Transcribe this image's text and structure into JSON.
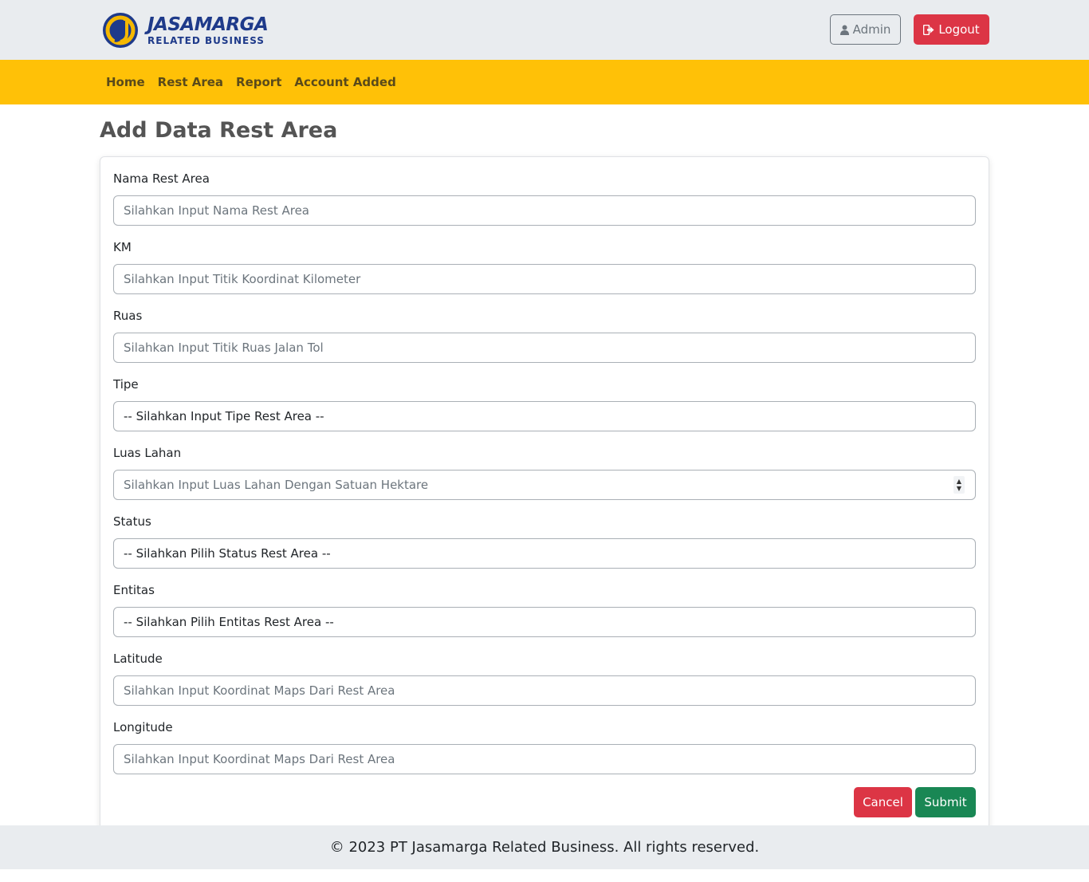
{
  "header": {
    "brand_name": "JASAMARGA",
    "brand_sub": "RELATED BUSINESS",
    "admin_label": "Admin",
    "logout_label": "Logout"
  },
  "nav": {
    "items": [
      {
        "label": "Home"
      },
      {
        "label": "Rest Area"
      },
      {
        "label": "Report"
      },
      {
        "label": "Account Added"
      }
    ]
  },
  "page": {
    "title": "Add Data Rest Area"
  },
  "form": {
    "nama": {
      "label": "Nama Rest Area",
      "placeholder": "Silahkan Input Nama Rest Area"
    },
    "km": {
      "label": "KM",
      "placeholder": "Silahkan Input Titik Koordinat Kilometer"
    },
    "ruas": {
      "label": "Ruas",
      "placeholder": "Silahkan Input Titik Ruas Jalan Tol"
    },
    "tipe": {
      "label": "Tipe",
      "selected": "-- Silahkan Input Tipe Rest Area --"
    },
    "luas": {
      "label": "Luas Lahan",
      "placeholder": "Silahkan Input Luas Lahan Dengan Satuan Hektare"
    },
    "status": {
      "label": "Status",
      "selected": "-- Silahkan Pilih Status Rest Area --"
    },
    "entitas": {
      "label": "Entitas",
      "selected": "-- Silahkan Pilih Entitas Rest Area --"
    },
    "latitude": {
      "label": "Latitude",
      "placeholder": "Silahkan Input Koordinat Maps Dari Rest Area"
    },
    "longitude": {
      "label": "Longitude",
      "placeholder": "Silahkan Input Koordinat Maps Dari Rest Area"
    },
    "cancel_label": "Cancel",
    "submit_label": "Submit"
  },
  "footer": {
    "text": "© 2023 PT Jasamarga Related Business. All rights reserved."
  },
  "colors": {
    "navbar": "#ffc107",
    "topbar": "#e9ecef",
    "danger": "#dc3545",
    "success": "#198754",
    "brand": "#1e3a8a"
  },
  "icons": {
    "admin": "user-icon",
    "logout": "sign-out-icon"
  }
}
